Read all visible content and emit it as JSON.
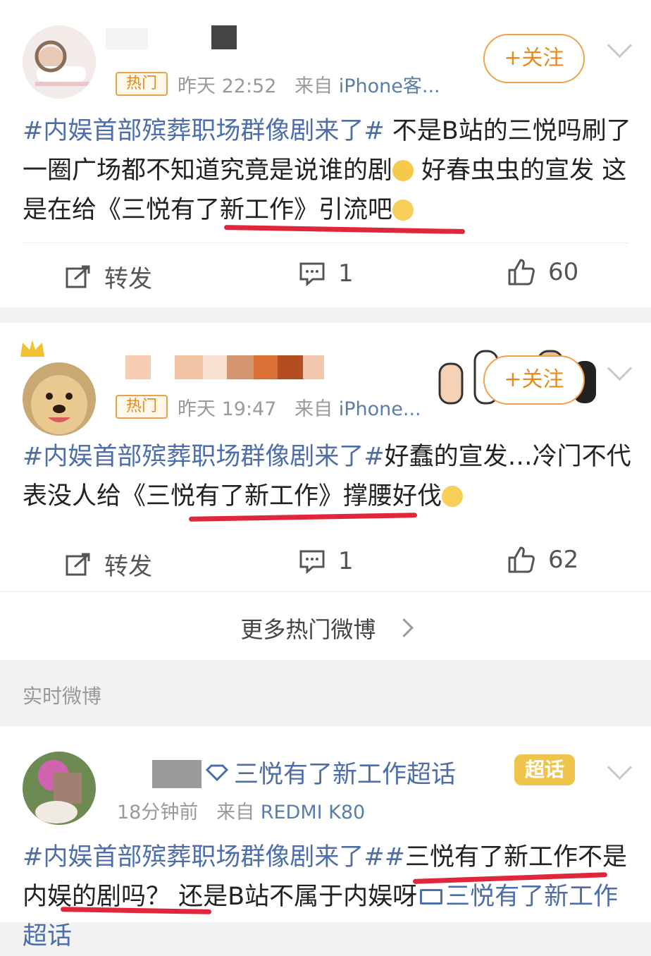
{
  "posts": [
    {
      "badge": "热门",
      "time": "昨天 22:52",
      "from_label": "来自",
      "source": "iPhone客...",
      "follow_label": "+关注",
      "text": {
        "tag": "#内娱首部殡葬职场群像剧来了#",
        "seg1": " 不是B站的三悦吗刷了一圈广场都不知道究竟是说谁的剧",
        "seg2": " 好春虫虫的宣发 这是在给",
        "book": "《三悦有了新工作》",
        "seg3": "引流吧"
      },
      "actions": {
        "repost": "转发",
        "comments": "1",
        "likes": "60"
      }
    },
    {
      "badge": "热门",
      "time": "昨天 19:47",
      "from_label": "来自",
      "source": "iPhone...",
      "follow_label": "+关注",
      "text": {
        "tag": "#内娱首部殡葬职场群像剧来了#",
        "seg1": "好蠢的宣发…冷门不代表没人给",
        "book": "《三悦有了新工作》",
        "seg2": "撑腰好伐"
      },
      "actions": {
        "repost": "转发",
        "comments": "1",
        "likes": "62"
      }
    }
  ],
  "more_label": "更多热门微博",
  "section_title": "实时微博",
  "realtime_post": {
    "supertopic": "三悦有了新工作超话",
    "supertopic_badge": "超话",
    "time": "18分钟前",
    "from_label": "来自",
    "source": "REDMI K80",
    "text": {
      "tag": "#内娱首部殡葬职场群像剧来了#",
      "tag2": "三悦有了新工作",
      "seg1": "不是内娱的剧吗？ 还是B站不属于内娱呀",
      "tail": "三悦有了新工作超话"
    }
  },
  "colors": {
    "accent": "#e88a1f",
    "link": "#4d6ea8",
    "underline": "#e0263a"
  }
}
